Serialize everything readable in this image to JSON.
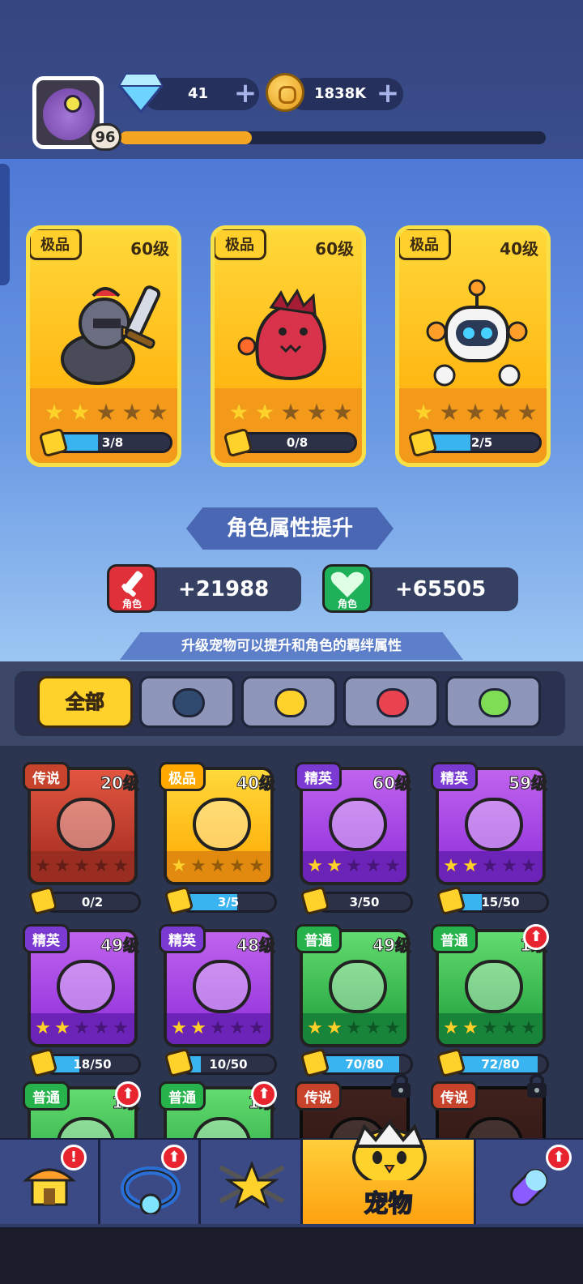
{
  "player": {
    "level": "96",
    "xp_fraction": 0.31
  },
  "resources": {
    "gems": "41",
    "gold": "1838K",
    "plus": "+"
  },
  "featured_pets": [
    {
      "rarity": "极品",
      "level": "60级",
      "stars": 2,
      "progress_text": "3/8",
      "progress": 0.375
    },
    {
      "rarity": "极品",
      "level": "60级",
      "stars": 2,
      "progress_text": "0/8",
      "progress": 0
    },
    {
      "rarity": "极品",
      "level": "40级",
      "stars": 1,
      "progress_text": "2/5",
      "progress": 0.4
    }
  ],
  "attributes": {
    "title": "角色属性提升",
    "attack": {
      "label": "角色",
      "value": "+21988"
    },
    "health": {
      "label": "角色",
      "value": "+65505"
    },
    "hint": "升级宠物可以提升和角色的羁绊属性"
  },
  "filters": {
    "all": "全部",
    "icons": [
      "robot-filter-icon",
      "chick-filter-icon",
      "fire-filter-icon",
      "plant-filter-icon"
    ]
  },
  "pets": [
    {
      "rarity": "传说",
      "tier": "legend",
      "level": "20级",
      "stars": 0,
      "progress_text": "0/2",
      "progress": 0,
      "upgrade": false,
      "locked": false
    },
    {
      "rarity": "极品",
      "tier": "epic",
      "level": "40级",
      "stars": 1,
      "progress_text": "3/5",
      "progress": 0.6,
      "upgrade": false,
      "locked": false
    },
    {
      "rarity": "精英",
      "tier": "elite",
      "level": "60级",
      "stars": 2,
      "progress_text": "3/50",
      "progress": 0.06,
      "upgrade": false,
      "locked": false
    },
    {
      "rarity": "精英",
      "tier": "elite",
      "level": "59级",
      "stars": 2,
      "progress_text": "15/50",
      "progress": 0.3,
      "upgrade": false,
      "locked": false
    },
    {
      "rarity": "精英",
      "tier": "elite",
      "level": "49级",
      "stars": 2,
      "progress_text": "18/50",
      "progress": 0.36,
      "upgrade": false,
      "locked": false
    },
    {
      "rarity": "精英",
      "tier": "elite",
      "level": "48级",
      "stars": 2,
      "progress_text": "10/50",
      "progress": 0.2,
      "upgrade": false,
      "locked": false
    },
    {
      "rarity": "普通",
      "tier": "normal",
      "level": "49级",
      "stars": 2,
      "progress_text": "70/80",
      "progress": 0.875,
      "upgrade": false,
      "locked": false
    },
    {
      "rarity": "普通",
      "tier": "normal",
      "level": "1级",
      "stars": 2,
      "progress_text": "72/80",
      "progress": 0.9,
      "upgrade": true,
      "locked": false
    },
    {
      "rarity": "普通",
      "tier": "normal",
      "level": "1级",
      "stars": 0,
      "progress_text": "",
      "progress": 0,
      "upgrade": true,
      "locked": false
    },
    {
      "rarity": "普通",
      "tier": "normal",
      "level": "1级",
      "stars": 0,
      "progress_text": "",
      "progress": 0,
      "upgrade": true,
      "locked": false
    },
    {
      "rarity": "传说",
      "tier": "legend",
      "level": "",
      "stars": 0,
      "progress_text": "",
      "progress": 0,
      "upgrade": false,
      "locked": true
    },
    {
      "rarity": "传说",
      "tier": "legend",
      "level": "",
      "stars": 0,
      "progress_text": "",
      "progress": 0,
      "upgrade": false,
      "locked": true
    }
  ],
  "nav": {
    "shop": {
      "alert": "!"
    },
    "ring": {
      "alert": "⬆"
    },
    "star": {},
    "pet": {
      "label": "宠物"
    },
    "capsule": {
      "alert": "⬆"
    }
  }
}
